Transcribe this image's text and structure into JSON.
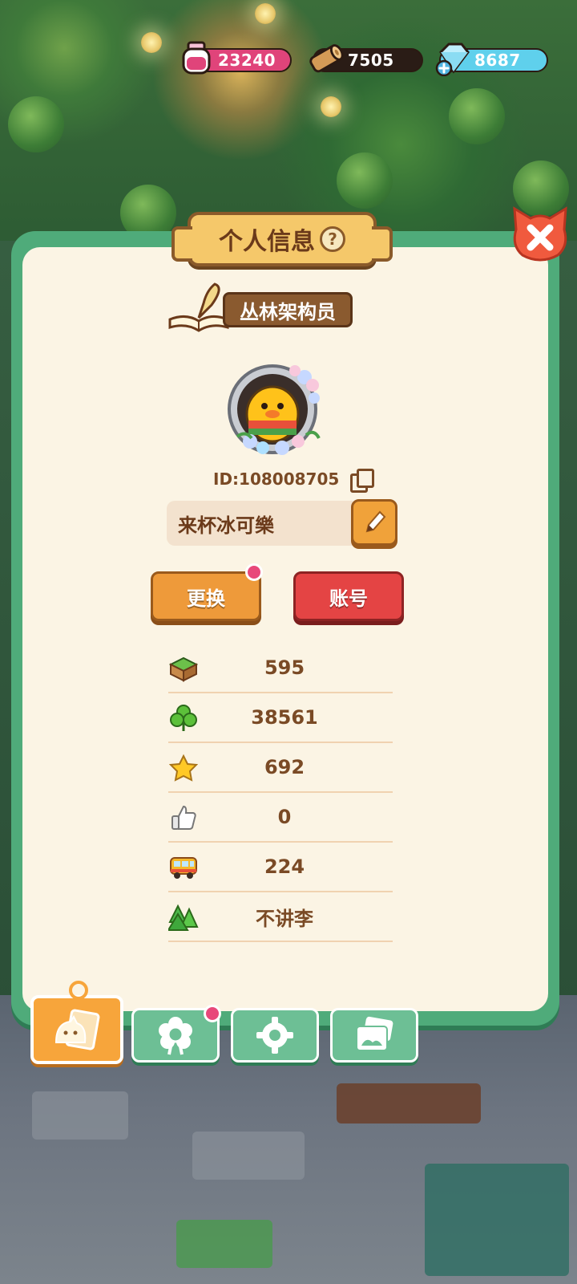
{
  "resources": {
    "ink": {
      "value": "23240",
      "icon": "ink-bottle-icon",
      "color": "#e0447a"
    },
    "wood": {
      "value": "7505",
      "icon": "wood-log-icon",
      "color": "#2a1c16"
    },
    "gems": {
      "value": "8687",
      "icon": "diamond-plus-icon",
      "color": "#5fd0ec"
    }
  },
  "panel": {
    "title": "个人信息",
    "help": "?",
    "rank": "丛林架构员",
    "player_id": "ID:108008705",
    "nickname": "来杯冰可樂",
    "change_label": "更换",
    "account_label": "账号"
  },
  "stats": [
    {
      "icon": "grass-block-icon",
      "value": "595"
    },
    {
      "icon": "clover-icon",
      "value": "38561"
    },
    {
      "icon": "star-icon",
      "value": "692"
    },
    {
      "icon": "thumbs-up-icon",
      "value": "0"
    },
    {
      "icon": "bus-icon",
      "value": "224"
    },
    {
      "icon": "pine-trees-icon",
      "value": "不讲李"
    }
  ],
  "tabs": [
    {
      "name": "profile",
      "icon": "profile-card-icon",
      "active": true
    },
    {
      "name": "badges",
      "icon": "flower-badge-icon",
      "active": false,
      "notification": true
    },
    {
      "name": "settings",
      "icon": "gear-icon",
      "active": false
    },
    {
      "name": "album",
      "icon": "photo-album-icon",
      "active": false
    }
  ],
  "colors": {
    "panel_green": "#4fab7a",
    "panel_bg": "#fbf4e4",
    "accent_orange": "#f0a23a",
    "accent_red": "#e44444",
    "text_brown": "#7a4a25"
  }
}
